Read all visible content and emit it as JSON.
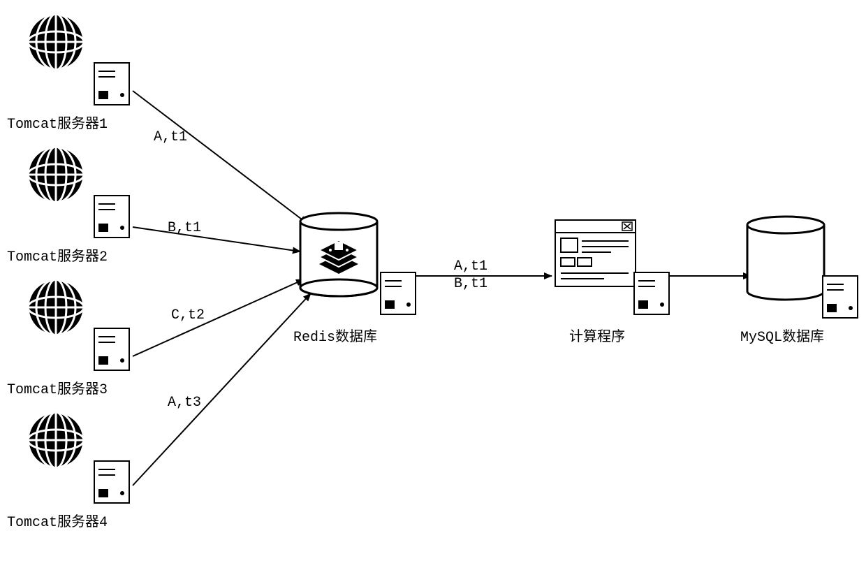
{
  "diagram": {
    "nodes": {
      "tomcat1": {
        "label": "Tomcat服务器1"
      },
      "tomcat2": {
        "label": "Tomcat服务器2"
      },
      "tomcat3": {
        "label": "Tomcat服务器3"
      },
      "tomcat4": {
        "label": "Tomcat服务器4"
      },
      "redis": {
        "label": "Redis数据库"
      },
      "compute": {
        "label": "计算程序"
      },
      "mysql": {
        "label": "MySQL数据库"
      }
    },
    "edges": {
      "t1_redis": {
        "label": "A,t1"
      },
      "t2_redis": {
        "label": "B,t1"
      },
      "t3_redis": {
        "label": "C,t2"
      },
      "t4_redis": {
        "label": "A,t3"
      },
      "redis_compute": {
        "label_line1": "A,t1",
        "label_line2": "B,t1"
      }
    }
  }
}
